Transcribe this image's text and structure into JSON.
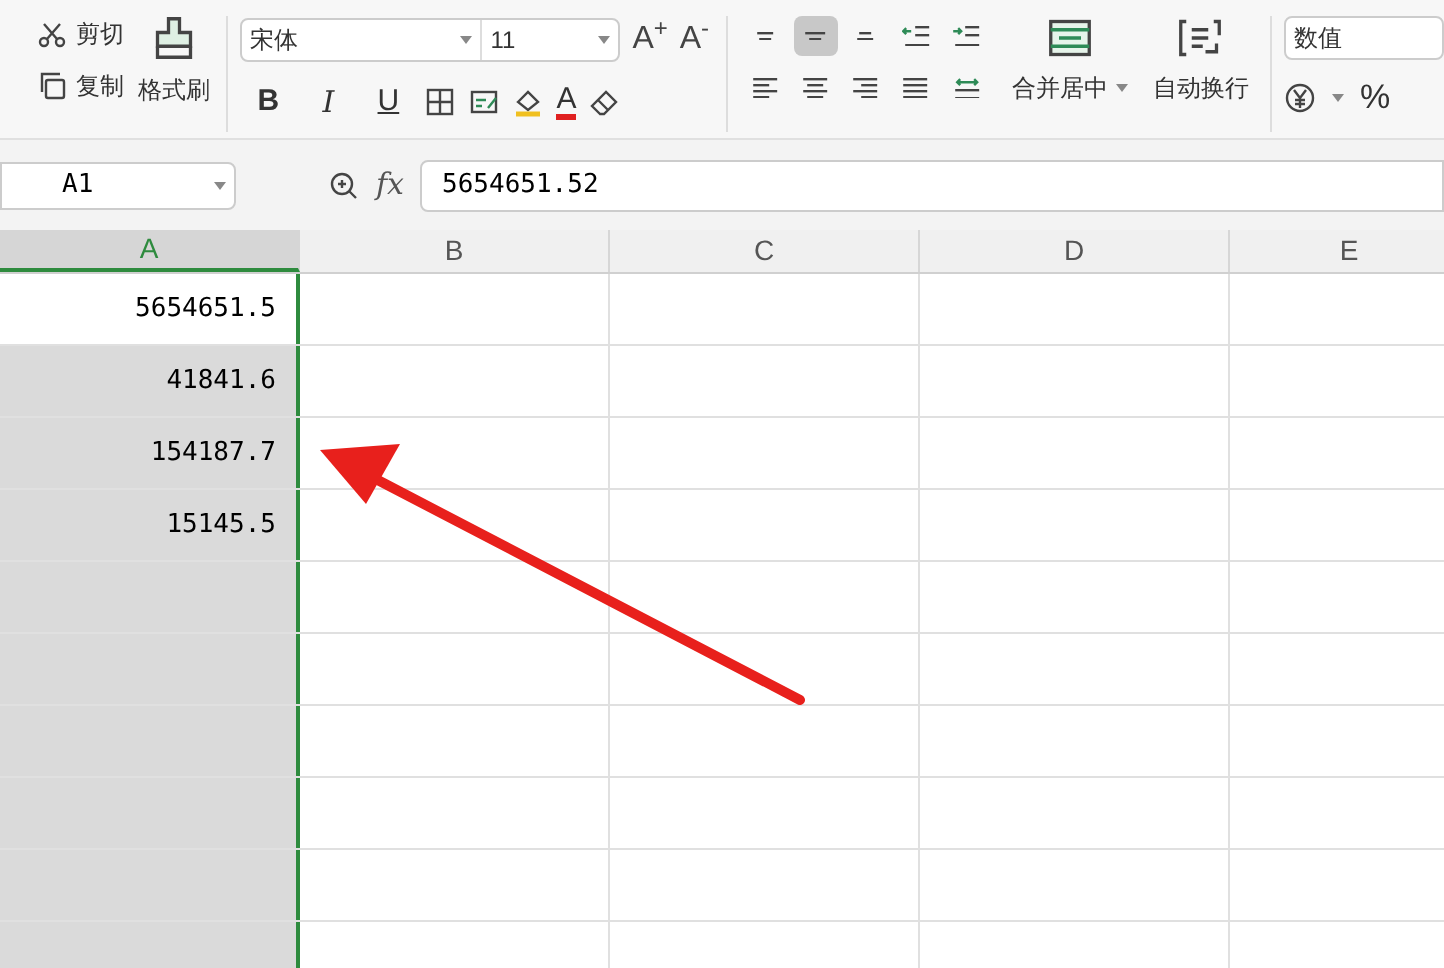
{
  "toolbar": {
    "clipboard": [
      {
        "kind": "cut",
        "label": "剪切"
      },
      {
        "kind": "copy",
        "label": "复制"
      }
    ],
    "format_painter": "格式刷",
    "font_name": "宋体",
    "font_size": "11",
    "size_buttons": [
      "A$^{+}$",
      "A$^{-}$"
    ],
    "style_buttons": [
      {
        "kind": "bold",
        "label": "B"
      },
      {
        "kind": "italic",
        "label": "I"
      },
      {
        "kind": "underline",
        "label": "U"
      }
    ],
    "font_color": "A",
    "align_buttons": [
      {
        "kind": "top",
        "selected": false
      },
      {
        "kind": "middle",
        "selected": true
      },
      {
        "kind": "bottom",
        "selected": false
      },
      {
        "kind": "outdent",
        "selected": false
      },
      {
        "kind": "indent",
        "selected": false
      },
      {
        "kind": "left",
        "selected": false
      },
      {
        "kind": "center",
        "selected": false
      },
      {
        "kind": "right",
        "selected": false
      },
      {
        "kind": "justify",
        "selected": false
      },
      {
        "kind": "distribute",
        "selected": false
      }
    ],
    "merge": "合并居中",
    "wrap": "自动换行",
    "number_format": "数值",
    "percent": "%"
  },
  "formula_bar": {
    "name_box": "A1",
    "fx": "fx",
    "value": "5654651.52"
  },
  "columns": [
    {
      "label": "A",
      "selected": true
    },
    {
      "label": "B",
      "selected": false
    },
    {
      "label": "C",
      "selected": false
    },
    {
      "label": "D",
      "selected": false
    },
    {
      "label": "E",
      "selected": false
    }
  ],
  "column_a": [
    "5654651.5",
    "41841.6",
    "154187.7",
    "15145.5"
  ],
  "annotations": [
    {
      "kind": "arrow"
    }
  ]
}
